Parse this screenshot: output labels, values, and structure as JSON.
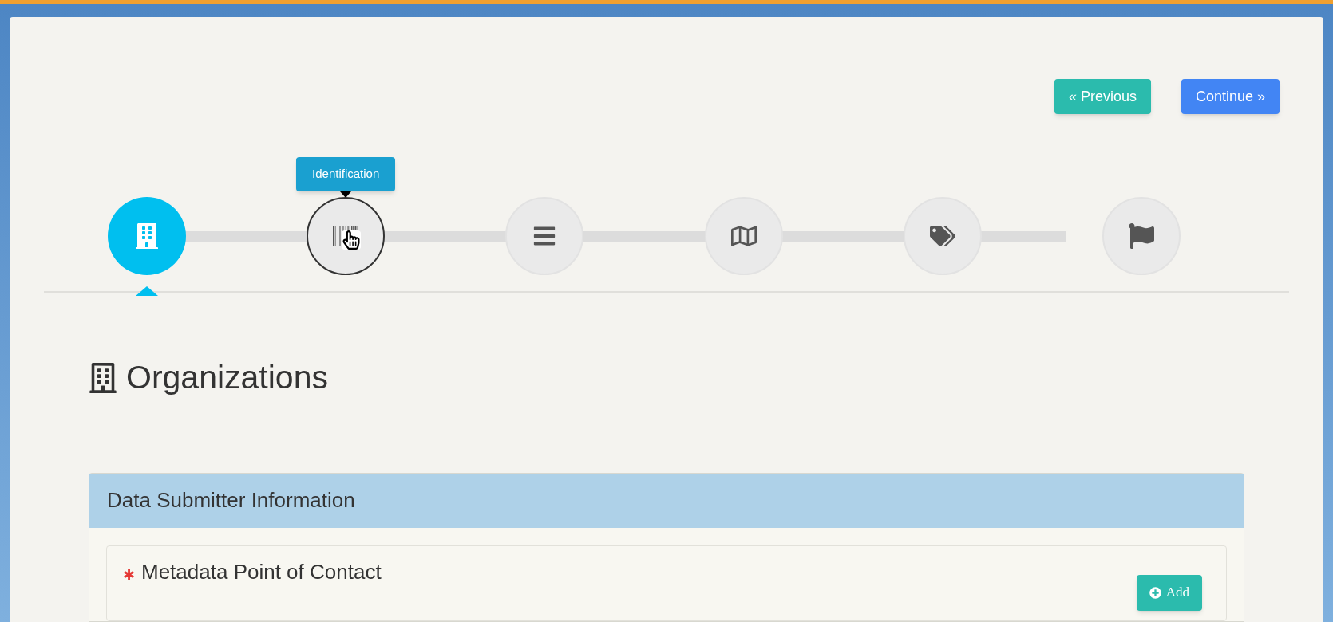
{
  "nav_buttons": [
    {
      "kind": "previous",
      "label": "« Previous"
    },
    {
      "kind": "continue",
      "label": "Continue »"
    }
  ],
  "steps": [
    {
      "kind": "building",
      "selected": true
    },
    {
      "kind": "barcode",
      "selected": false,
      "tooltip": "Identification"
    },
    {
      "kind": "bars",
      "selected": false
    },
    {
      "kind": "map",
      "selected": false
    },
    {
      "kind": "tags",
      "selected": false
    },
    {
      "kind": "flag",
      "selected": false
    }
  ],
  "heading": "Organizations",
  "panel": {
    "title": "Data Submitter Information",
    "section": {
      "required_mark": "✱",
      "title": "Metadata Point of Contact",
      "button": "Add"
    }
  }
}
